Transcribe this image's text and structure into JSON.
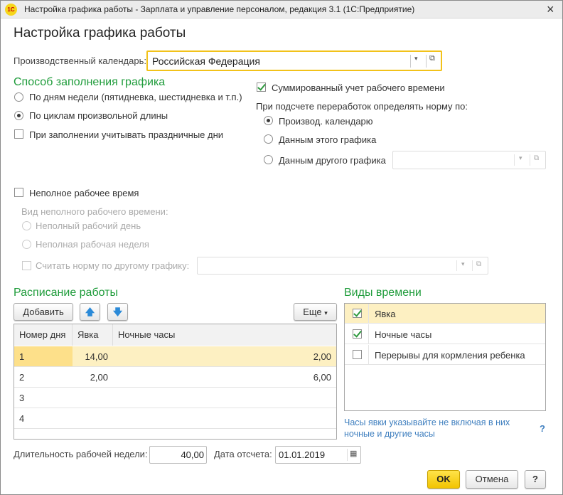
{
  "window": {
    "logo": "1С",
    "title": "Настройка графика работы - Зарплата и управление персоналом, редакция 3.1  (1С:Предприятие)",
    "close": "×"
  },
  "heading": "Настройка графика работы",
  "calendar": {
    "label": "Производственный календарь:",
    "value": "Российская Федерация"
  },
  "fill_method": {
    "title": "Способ заполнения графика",
    "options": [
      "По дням недели (пятидневка, шестидневка и т.п.)",
      "По циклам произвольной длины"
    ],
    "selected": 1,
    "holidays_label": "При заполнении учитывать праздничные дни"
  },
  "summary": {
    "label": "Суммированный учет рабочего времени",
    "checked": true,
    "norm_label": "При подсчете переработок определять норму по:",
    "options": [
      "Производ. календарю",
      "Данным этого графика",
      "Данным другого графика"
    ],
    "selected": 0
  },
  "part_time": {
    "label": "Неполное рабочее время",
    "kind_label": "Вид неполного рабочего времени:",
    "options": [
      "Неполный рабочий день",
      "Неполная рабочая неделя"
    ],
    "other_norm_label": "Считать норму по другому графику:"
  },
  "schedule": {
    "title": "Расписание работы",
    "add": "Добавить",
    "more": "Еще",
    "columns": [
      "Номер дня",
      "Явка",
      "Ночные часы"
    ],
    "rows": [
      {
        "day": "1",
        "attend": "14,00",
        "night": "2,00"
      },
      {
        "day": "2",
        "attend": "2,00",
        "night": "6,00"
      },
      {
        "day": "3",
        "attend": "",
        "night": ""
      },
      {
        "day": "4",
        "attend": "",
        "night": ""
      }
    ]
  },
  "time_types": {
    "title": "Виды времени",
    "items": [
      {
        "label": "Явка",
        "checked": true
      },
      {
        "label": "Ночные часы",
        "checked": true
      },
      {
        "label": "Перерывы для кормления ребенка",
        "checked": false
      }
    ],
    "hint1": "Часы явки указывайте не включая в них",
    "hint2": "ночные и другие часы",
    "help": "?"
  },
  "footer": {
    "week_label": "Длительность рабочей недели:",
    "week_value": "40,00",
    "date_label": "Дата отсчета:",
    "date_value": "01.01.2019",
    "ok": "OK",
    "cancel": "Отмена",
    "help": "?"
  }
}
